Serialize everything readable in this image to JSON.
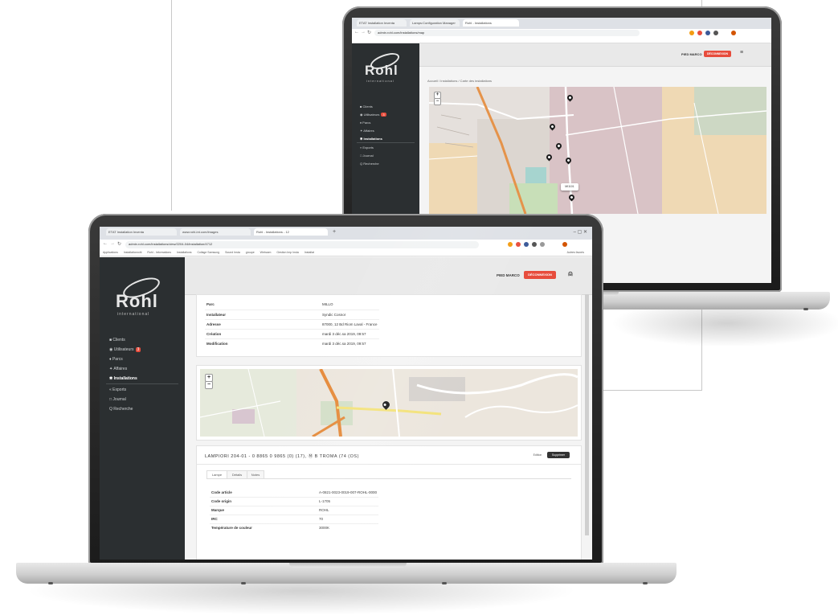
{
  "browser_back": {
    "tabs": [
      "ETAT Installation Inventa",
      "Lamps:Configuration Manager",
      "Rohl - Installations"
    ],
    "url": "admin.rohl.com/installations/map"
  },
  "browser_front": {
    "tabs": [
      "ETAT Installation Inventa",
      "www.rohl-int.com/images",
      "Rohl - Installations - 12"
    ],
    "url": "admin.rohl.com/installations/view/2204-04/installation/4712",
    "bookmarks": [
      "Applications",
      "Installationrohl",
      "Rohl - Informations",
      "Installations",
      "Collage Samsung",
      "Sound Insta",
      "groupe",
      "Webcam",
      "Gestion Imp Insta",
      "Installat",
      "Autres favoris"
    ]
  },
  "app": {
    "logo_text": "Rohl",
    "logo_sub": "international",
    "nav": [
      {
        "label": "Clients",
        "icon": "■"
      },
      {
        "label": "Utilisateurs",
        "icon": "◉",
        "badge": "3"
      },
      {
        "label": "Parcs",
        "icon": "♦"
      },
      {
        "label": "Affaires",
        "icon": "✦"
      },
      {
        "label": "Installations",
        "icon": "✱"
      },
      {
        "label": "Exports",
        "icon": "«"
      },
      {
        "label": "Journal",
        "icon": "□"
      },
      {
        "label": "Recherche",
        "icon": "Q"
      }
    ],
    "user_name": "PIED MARCO",
    "logout_label": "DÉCONNEXION",
    "user_icon": "user-icon"
  },
  "back_view": {
    "breadcrumb": "Accueil  /  Installations  /  Carte des installations",
    "popup_label": "MI1101",
    "zoom_in": "+",
    "zoom_out": "−"
  },
  "front_view": {
    "info_rows": [
      {
        "key": "Parc",
        "value": "MILLO"
      },
      {
        "key": "Installateur",
        "value": "Syndic Cosnor"
      },
      {
        "key": "Adresse",
        "value": "87000, 12 Bd Riom Laval - France"
      },
      {
        "key": "Création",
        "value": "mardi 3 déc.sa 2019, 09:57"
      },
      {
        "key": "Modification",
        "value": "mardi 3 déc.sa 2019, 09:57"
      }
    ],
    "zoom_in": "+",
    "zoom_out": "−",
    "lamp_title": "LAMPIORI 204-01 - 0 8865 0 9865 (0) (17), Ⓜ B TROMA (74 (OS)",
    "lamp_btn_light": "Edition",
    "lamp_btn_dark": "Supprimer",
    "subtabs": [
      "Lampe",
      "Détails",
      "Notes"
    ],
    "detail_rows": [
      {
        "key": "Code article",
        "value": "A-0821-0023-0019-007-ROHL-0000"
      },
      {
        "key": "Code origin",
        "value": "L-1705"
      },
      {
        "key": "Marque",
        "value": "ROHL"
      },
      {
        "key": "IRC",
        "value": "70"
      },
      {
        "key": "Température de couleur",
        "value": "3000K"
      }
    ]
  }
}
